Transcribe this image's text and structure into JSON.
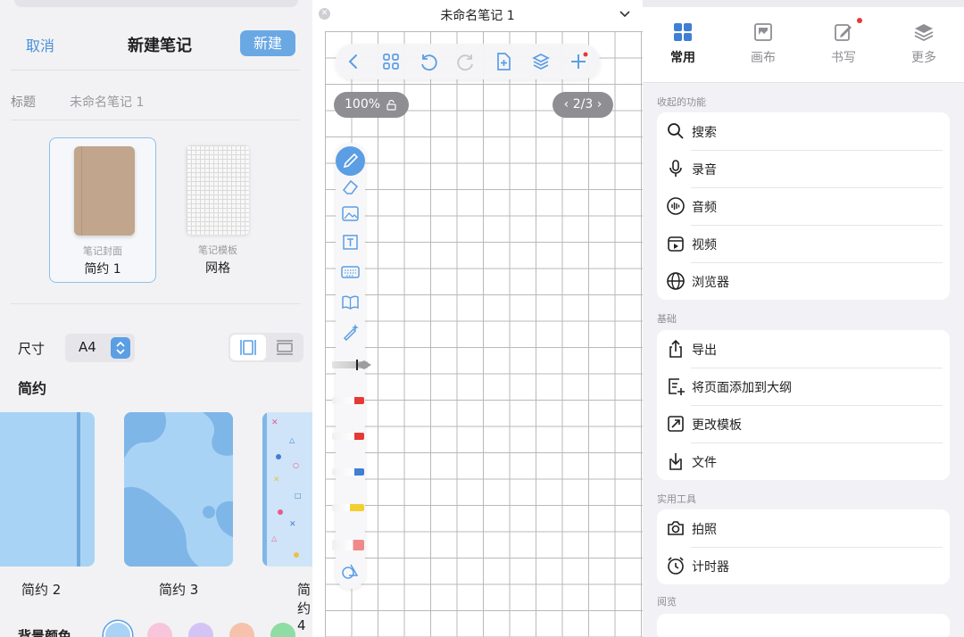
{
  "new_note": {
    "cancel_label": "取消",
    "title": "新建笔记",
    "create_label": "新建",
    "title_field_label": "标题",
    "title_field_value": "未命名笔记 1",
    "cover": {
      "sub": "笔记封面",
      "name": "简约 1"
    },
    "template": {
      "sub": "笔记模板",
      "name": "网格"
    },
    "size_label": "尺寸",
    "size_value": "A4",
    "section_label": "简约",
    "covers": [
      "简约 2",
      "简约 3",
      "简约 4"
    ],
    "bg_color_label": "背景颜色",
    "swatches": [
      "#a9d3f5",
      "#f7c6dc",
      "#d4c4f5",
      "#f6c2ab",
      "#8fdca4"
    ]
  },
  "editor": {
    "note_title": "未命名笔记 1",
    "zoom": "100%",
    "page_indicator": "2/3",
    "toolbar_icons": [
      "back-icon",
      "grid-view-icon",
      "undo-icon",
      "redo-icon",
      "add-page-icon",
      "layers-icon",
      "add-icon"
    ]
  },
  "side_menu": {
    "tabs": [
      {
        "label": "常用",
        "icon": "common-icon",
        "active": true
      },
      {
        "label": "画布",
        "icon": "canvas-icon",
        "active": false
      },
      {
        "label": "书写",
        "icon": "writing-icon",
        "active": false
      },
      {
        "label": "更多",
        "icon": "more-icon",
        "active": false
      }
    ],
    "sections": {
      "collapsed": {
        "title": "收起的功能",
        "items": [
          "搜索",
          "录音",
          "音频",
          "视频",
          "浏览器"
        ]
      },
      "basic": {
        "title": "基础",
        "items": [
          "导出",
          "将页面添加到大纲",
          "更改模板",
          "文件"
        ]
      },
      "tools": {
        "title": "实用工具",
        "items": [
          "拍照",
          "计时器"
        ]
      },
      "browse": {
        "title": "阅览"
      }
    }
  },
  "colors": {
    "accent": "#5b9ee4",
    "accent_text": "#4a90d9",
    "badge": "#e53935"
  }
}
